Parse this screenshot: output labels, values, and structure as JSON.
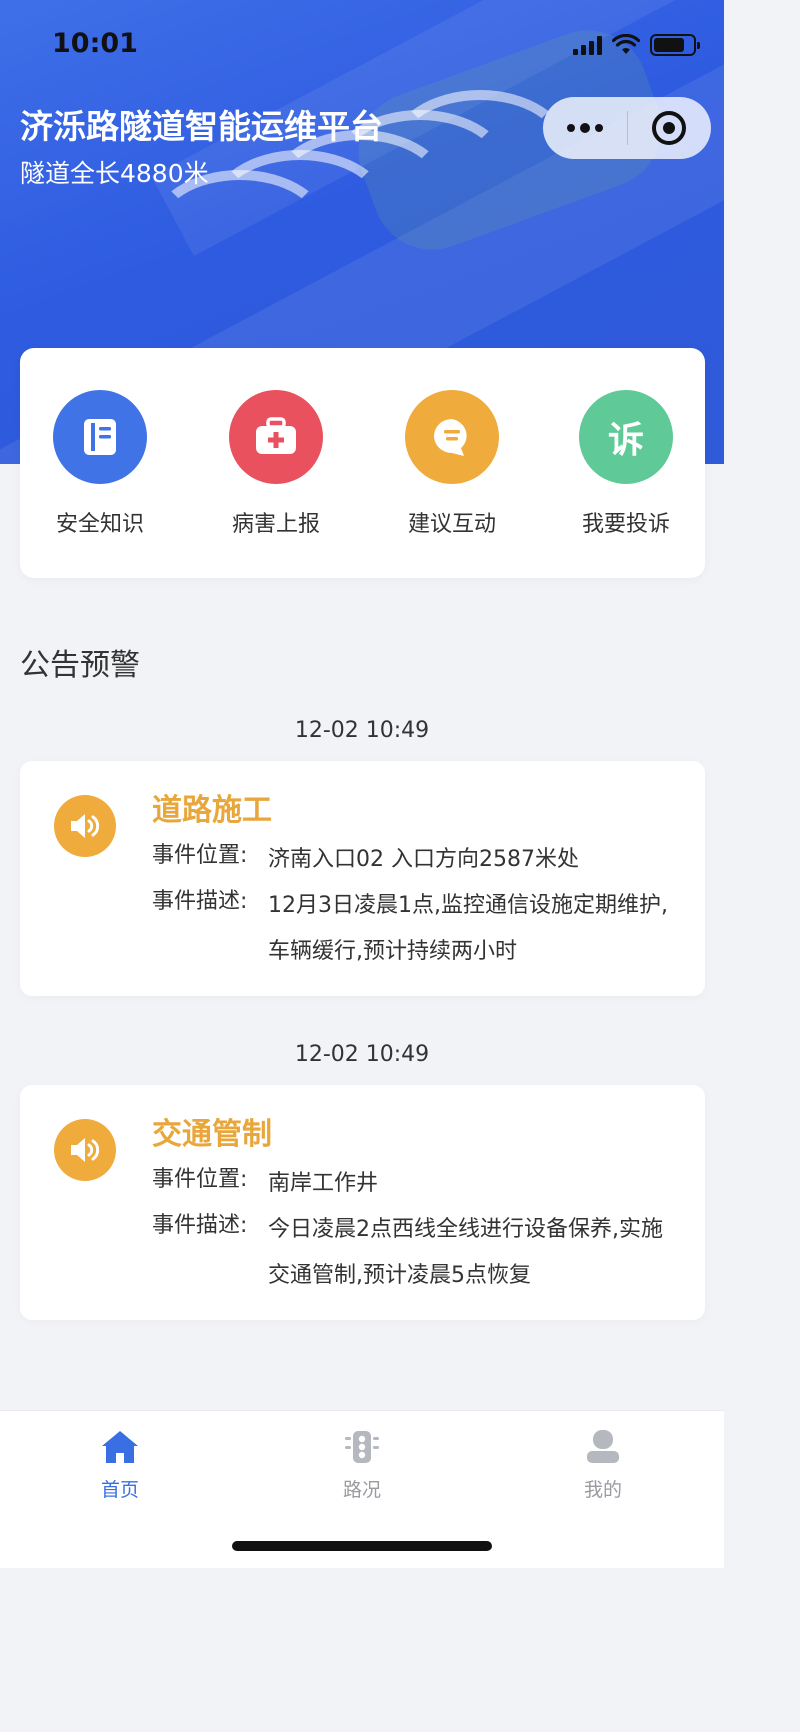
{
  "status_bar": {
    "time": "10:01"
  },
  "header": {
    "title": "济泺路隧道智能运维平台",
    "subtitle": "隧道全长4880米"
  },
  "menu": [
    {
      "label": "安全知识",
      "icon": "book-icon",
      "color": "#3f73e6"
    },
    {
      "label": "病害上报",
      "icon": "medical-kit-icon",
      "color": "#e8515d"
    },
    {
      "label": "建议互动",
      "icon": "chat-bubble-icon",
      "color": "#efab3b"
    },
    {
      "label": "我要投诉",
      "icon": "complain-icon",
      "glyph": "诉",
      "color": "#5fca97"
    }
  ],
  "section_title": "公告预警",
  "notices": [
    {
      "time": "12-02 10:49",
      "title": "道路施工",
      "location_label": "事件位置:",
      "location": "济南入口02 入口方向2587米处",
      "desc_label": "事件描述:",
      "desc": "12月3日凌晨1点,监控通信设施定期维护,车辆缓行,预计持续两小时"
    },
    {
      "time": "12-02 10:49",
      "title": "交通管制",
      "location_label": "事件位置:",
      "location": "南岸工作井",
      "desc_label": "事件描述:",
      "desc": "今日凌晨2点西线全线进行设备保养,实施交通管制,预计凌晨5点恢复"
    }
  ],
  "tabbar": [
    {
      "label": "首页",
      "icon": "home-icon",
      "active": true
    },
    {
      "label": "路况",
      "icon": "traffic-light-icon",
      "active": false
    },
    {
      "label": "我的",
      "icon": "user-icon",
      "active": false
    }
  ],
  "colors": {
    "accent": "#3a6fe3",
    "warning": "#e9a63a"
  }
}
